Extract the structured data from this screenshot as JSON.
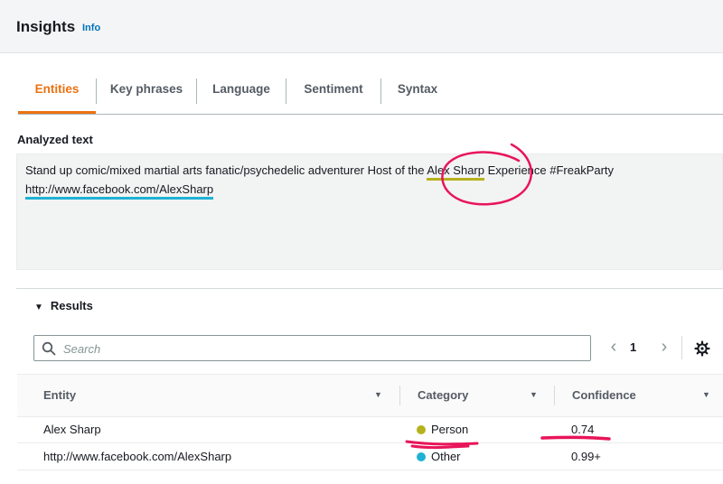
{
  "header": {
    "title": "Insights",
    "info_link": "Info"
  },
  "tabs": [
    {
      "label": "Entities",
      "active": true
    },
    {
      "label": "Key phrases",
      "active": false
    },
    {
      "label": "Language",
      "active": false
    },
    {
      "label": "Sentiment",
      "active": false
    },
    {
      "label": "Syntax",
      "active": false
    }
  ],
  "analyzed": {
    "label": "Analyzed text",
    "line1_before": "Stand up comic/mixed martial arts fanatic/psychedelic adventurer Host of the ",
    "line1_entity": "Alex Sharp",
    "line1_after": " Experience #FreakParty",
    "line2_entity": "http://www.facebook.com/AlexSharp"
  },
  "results": {
    "label": "Results",
    "search_placeholder": "Search",
    "page": "1",
    "columns": [
      "Entity",
      "Category",
      "Confidence"
    ],
    "rows": [
      {
        "entity": "Alex Sharp",
        "category": "Person",
        "category_color": "#b5b21d",
        "confidence": "0.74"
      },
      {
        "entity": "http://www.facebook.com/AlexSharp",
        "category": "Other",
        "category_color": "#1fb2d4",
        "confidence": "0.99+"
      }
    ]
  },
  "colors": {
    "accent": "#ec7211",
    "annotation": "#e8155a"
  }
}
